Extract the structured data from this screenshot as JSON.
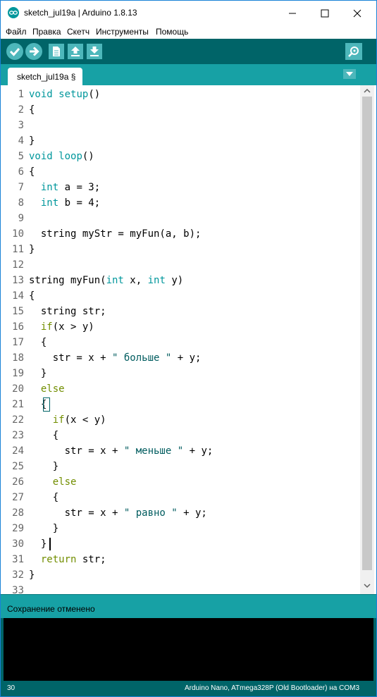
{
  "window": {
    "title": "sketch_jul19a | Arduino 1.8.13",
    "accent_color": "#00979c",
    "toolbar_color": "#006468",
    "tab_bar_color": "#17a1a5"
  },
  "menu": {
    "items": [
      "Файл",
      "Правка",
      "Скетч",
      "Инструменты",
      "Помощь"
    ]
  },
  "toolbar": {
    "buttons": [
      "verify-icon",
      "upload-icon",
      "new-icon",
      "open-icon",
      "save-icon",
      "serial-monitor-icon"
    ]
  },
  "tab": {
    "label": "sketch_jul19a §"
  },
  "editor": {
    "line_numbers": [
      "1",
      "2",
      "3",
      "4",
      "5",
      "6",
      "7",
      "8",
      "9",
      "10",
      "11",
      "12",
      "13",
      "14",
      "15",
      "16",
      "17",
      "18",
      "19",
      "20",
      "21",
      "22",
      "23",
      "24",
      "25",
      "26",
      "27",
      "28",
      "29",
      "30",
      "31",
      "32",
      "33"
    ],
    "code": [
      "void setup()",
      "{",
      "",
      "}",
      "void loop()",
      "{",
      "  int a = 3;",
      "  int b = 4;",
      "",
      "  string myStr = myFun(a, b);",
      "}",
      "",
      "string myFun(int x, int y)",
      "{",
      "  string str;",
      "  if(x > y)",
      "  {",
      "    str = x + \" больше \" + y;",
      "  }",
      "  else",
      "  {",
      "    if(x < y)",
      "    {",
      "      str = x + \" меньше \" + y;",
      "    }",
      "    else",
      "    {",
      "      str = x + \" равно \" + y;",
      "    }",
      "  }",
      "  return str;",
      "}",
      ""
    ]
  },
  "status": {
    "message": "Сохранение отменено"
  },
  "footer": {
    "line": "30",
    "board": "Arduino Nano, ATmega328P (Old Bootloader) на COM3"
  }
}
